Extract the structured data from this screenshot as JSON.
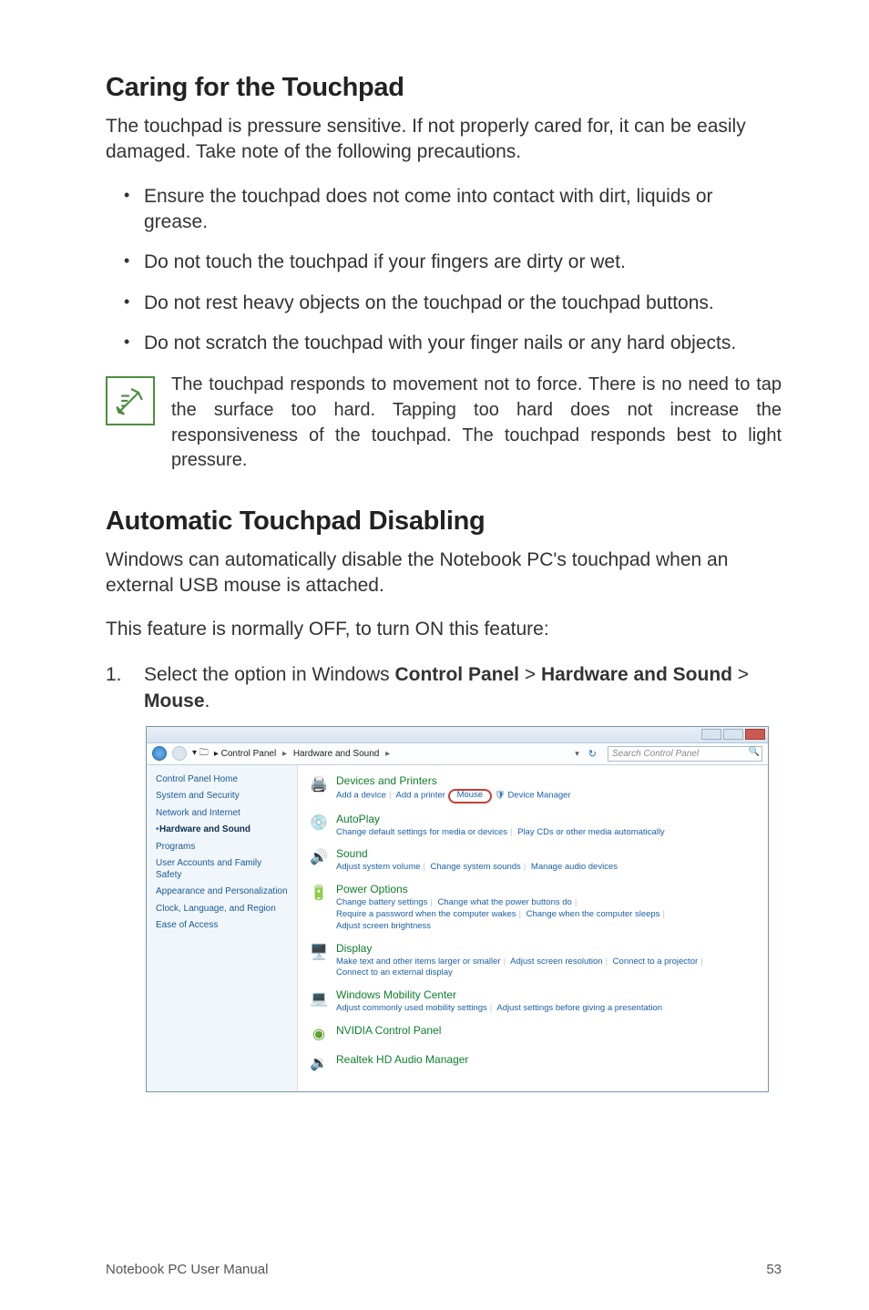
{
  "headings": {
    "h1": "Caring for the Touchpad",
    "h2": "Automatic Touchpad Disabling"
  },
  "paragraphs": {
    "intro1": "The touchpad is pressure sensitive. If not properly cared for, it can be easily damaged. Take note of the following precautions.",
    "intro2": "Windows can automatically disable the Notebook PC's touchpad when an external USB mouse is attached.",
    "intro3": "This feature is normally OFF, to turn ON this feature:"
  },
  "bullets": [
    "Ensure the touchpad does not come into contact with dirt, liquids or grease.",
    "Do not touch the touchpad if your fingers are dirty or wet.",
    "Do not rest heavy objects on the touchpad or the touchpad buttons.",
    "Do not scratch the touchpad with your finger nails or any hard objects."
  ],
  "note": "The touchpad responds to movement not to force. There is no need to tap the surface too hard. Tapping too hard does not increase the responsiveness of the touchpad. The touchpad responds best to light pressure.",
  "step": {
    "num": "1.",
    "text_a": "Select the option in Windows ",
    "b1": "Control Panel",
    "gt1": " > ",
    "b2": "Hardware and Sound",
    "gt2": " > ",
    "b3": "Mouse",
    "dot": "."
  },
  "screenshot": {
    "breadcrumb": {
      "root": "Control Panel",
      "current": "Hardware and Sound"
    },
    "search_placeholder": "Search Control Panel",
    "sidebar": [
      {
        "label": "Control Panel Home",
        "active": false
      },
      {
        "label": "System and Security",
        "active": false
      },
      {
        "label": "Network and Internet",
        "active": false
      },
      {
        "label": "Hardware and Sound",
        "active": true
      },
      {
        "label": "Programs",
        "active": false
      },
      {
        "label": "User Accounts and Family Safety",
        "active": false
      },
      {
        "label": "Appearance and Personalization",
        "active": false
      },
      {
        "label": "Clock, Language, and Region",
        "active": false
      },
      {
        "label": "Ease of Access",
        "active": false
      }
    ],
    "categories": {
      "devices": {
        "title": "Devices and Printers",
        "links": {
          "a": "Add a device",
          "b": "Add a printer",
          "c": "Mouse",
          "d": "Device Manager"
        }
      },
      "autoplay": {
        "title": "AutoPlay",
        "links": {
          "a": "Change default settings for media or devices",
          "b": "Play CDs or other media automatically"
        }
      },
      "sound": {
        "title": "Sound",
        "links": {
          "a": "Adjust system volume",
          "b": "Change system sounds",
          "c": "Manage audio devices"
        }
      },
      "power": {
        "title": "Power Options",
        "links": {
          "a": "Change battery settings",
          "b": "Change what the power buttons do",
          "c": "Require a password when the computer wakes",
          "d": "Change when the computer sleeps",
          "e": "Adjust screen brightness"
        }
      },
      "display": {
        "title": "Display",
        "links": {
          "a": "Make text and other items larger or smaller",
          "b": "Adjust screen resolution",
          "c": "Connect to a projector",
          "d": "Connect to an external display"
        }
      },
      "mobility": {
        "title": "Windows Mobility Center",
        "links": {
          "a": "Adjust commonly used mobility settings",
          "b": "Adjust settings before giving a presentation"
        }
      },
      "nvidia": {
        "title": "NVIDIA Control Panel"
      },
      "realtek": {
        "title": "Realtek HD Audio Manager"
      }
    }
  },
  "footer": {
    "left": "Notebook PC User Manual",
    "right": "53"
  }
}
